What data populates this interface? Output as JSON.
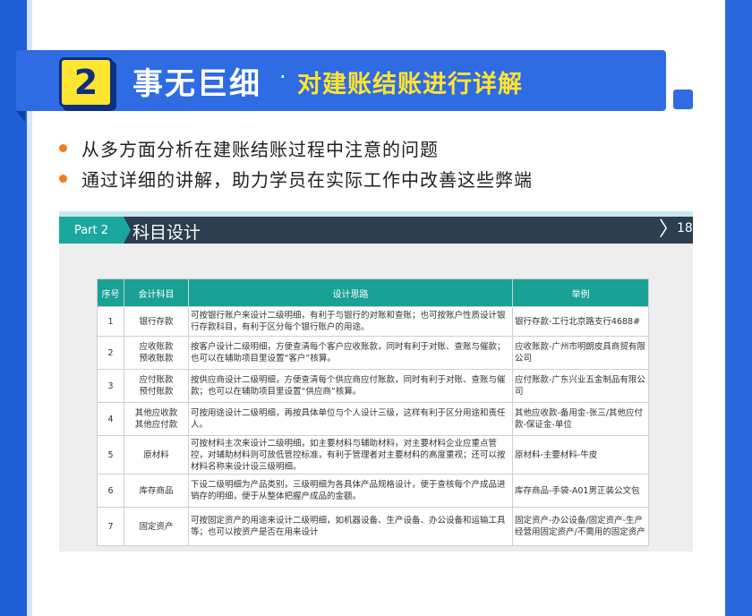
{
  "header": {
    "badge_number": "2",
    "title_main": "事无巨细",
    "title_dot": "·",
    "title_sub": "对建账结账进行详解"
  },
  "bullets": [
    "从多方面分析在建账结账过程中注意的问题",
    "通过详细的讲解，助力学员在实际工作中改善这些弊端"
  ],
  "slide": {
    "part_label": "Part 2",
    "title": "科目设计",
    "page_number": "18",
    "table": {
      "headers": [
        "序号",
        "会计科目",
        "设计思路",
        "举例"
      ],
      "rows": [
        [
          "1",
          "银行存款",
          "可按银行账户来设计二级明细，有利于与银行的对账和查账；也可按账户性质设计银行存款科目，有利于区分每个银行账户的用途。",
          "银行存款-工行北京路支行4688#"
        ],
        [
          "2",
          "应收账款\n预收账款",
          "按客户设计二级明细，方便查清每个客户应收账款，同时有利于对账、查账与催款；也可以在辅助项目里设置“客户”核算。",
          "应收账款-广州市明朗皮具商贸有限公司"
        ],
        [
          "3",
          "应付账款\n预付账款",
          "按供应商设计二级明细，方便查清每个供应商应付账款，同时有利于对账、查账与催款；也可以在辅助项目里设置“供应商”核算。",
          "应付账款-广东兴业五金制品有限公司"
        ],
        [
          "4",
          "其他应收款\n其他应付款",
          "可按用途设计二级明细，再按具体单位与个人设计三级，这样有利于区分用途和责任人。",
          "其他应收款-备用金-张三/其他应付款-保证金-单位"
        ],
        [
          "5",
          "原材料",
          "可按材料主次来设计二级明细，如主要材料与辅助材料，对主要材料企业应重点管控，对辅助材料则可放低管控标准，有利于管理者对主要材料的高度重视；还可以按材料名称来设计设三级明细。",
          "原材料-主要材料-牛皮"
        ],
        [
          "6",
          "库存商品",
          "下设二级明细为产品类别，三级明细为各具体产品规格设计，便于查核每个产成品进销存的明细，便于从整体把握产成品的金额。",
          "库存商品-手袋-A01男正装公文包"
        ],
        [
          "7",
          "固定资产",
          "可按固定资产的用途来设计二级明细，如机器设备、生产设备、办公设备和运输工具等；也可以按资产是否在用来设计",
          "固定资产-办公设备/固定资产-生产经营用固定资产/不需用的固定资产"
        ]
      ]
    }
  },
  "colors": {
    "frame_blue": "#1f5fd6",
    "banner_blue": "#2f6be3",
    "badge_yellow": "#ffe432",
    "bullet_orange": "#f07d21",
    "slide_band": "#2c3e4f",
    "teal": "#19a196"
  }
}
